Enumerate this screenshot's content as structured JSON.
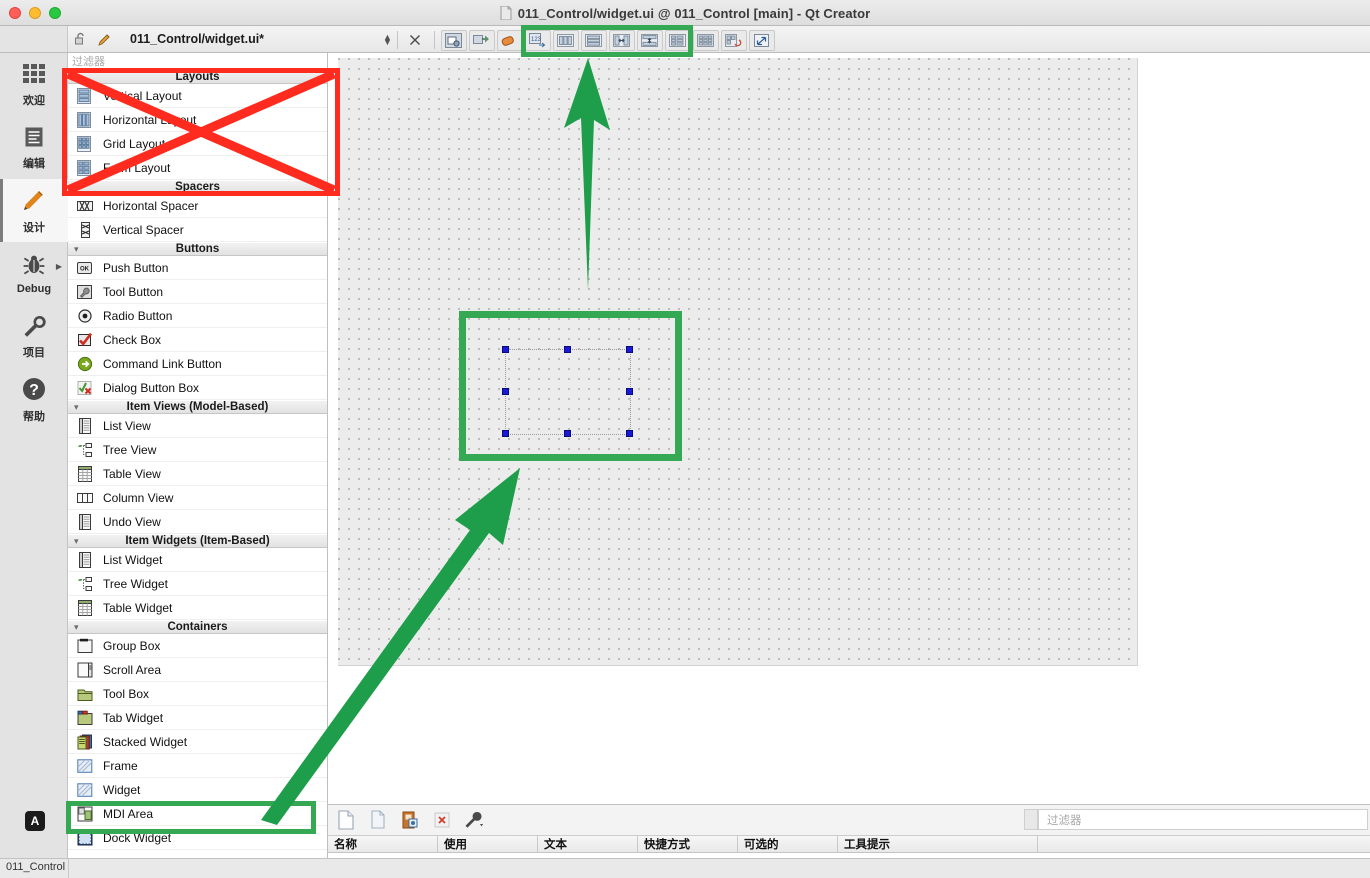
{
  "window": {
    "title": "011_Control/widget.ui @ 011_Control [main] - Qt Creator",
    "doc_icon": "document-icon",
    "traffic": {
      "close": "close-window-button",
      "minimize": "minimize-window-button",
      "zoom": "zoom-window-button"
    }
  },
  "editor_toolbar": {
    "lock_icon": "unlocked-padlock-icon",
    "edit_icon": "pencil-edit-icon",
    "file_name": "011_Control/widget.ui*",
    "dropdown_icon": "updown-chevron-icon",
    "close_icon": "close-editor-icon",
    "designer_buttons": [
      {
        "name": "edit-widgets-button",
        "icon": "edit-widgets-icon"
      },
      {
        "name": "edit-signals-slots-button",
        "icon": "signals-slots-icon"
      },
      {
        "name": "edit-buddies-button",
        "icon": "buddies-icon"
      },
      {
        "name": "edit-tab-order-button",
        "icon": "tab-order-icon"
      },
      {
        "name": "layout-horizontally-button",
        "icon": "layout-horizontal-icon"
      },
      {
        "name": "layout-vertically-button",
        "icon": "layout-vertical-icon"
      },
      {
        "name": "layout-horizontally-splitter-button",
        "icon": "splitter-horizontal-icon"
      },
      {
        "name": "layout-vertically-splitter-button",
        "icon": "splitter-vertical-icon"
      },
      {
        "name": "layout-form-button",
        "icon": "form-layout-icon"
      },
      {
        "name": "layout-grid-button",
        "icon": "grid-layout-icon"
      },
      {
        "name": "break-layout-button",
        "icon": "break-layout-icon"
      },
      {
        "name": "adjust-size-button",
        "icon": "adjust-size-icon"
      }
    ]
  },
  "mode_bar": {
    "items": [
      {
        "label": "欢迎",
        "icon": "welcome-grid-icon",
        "active": false,
        "has_arrow": false
      },
      {
        "label": "编辑",
        "icon": "edit-document-icon",
        "active": false,
        "has_arrow": false
      },
      {
        "label": "设计",
        "icon": "design-pencil-icon",
        "active": true,
        "has_arrow": false
      },
      {
        "label": "Debug",
        "icon": "debug-bug-icon",
        "active": false,
        "has_arrow": true
      },
      {
        "label": "项目",
        "icon": "projects-wrench-icon",
        "active": false,
        "has_arrow": false
      },
      {
        "label": "帮助",
        "icon": "help-question-icon",
        "active": false,
        "has_arrow": false
      }
    ],
    "badge": "A"
  },
  "status_bar": {
    "project": "011_Control"
  },
  "widget_box": {
    "filter_placeholder": "过滤器",
    "groups": [
      {
        "label": "Layouts",
        "items": [
          {
            "label": "Vertical Layout",
            "icon": "vertical-layout-icon"
          },
          {
            "label": "Horizontal Layout",
            "icon": "horizontal-layout-icon"
          },
          {
            "label": "Grid Layout",
            "icon": "grid-layout-icon"
          },
          {
            "label": "Form Layout",
            "icon": "form-layout-icon"
          }
        ]
      },
      {
        "label": "Spacers",
        "items": [
          {
            "label": "Horizontal Spacer",
            "icon": "horizontal-spacer-icon"
          },
          {
            "label": "Vertical Spacer",
            "icon": "vertical-spacer-icon"
          }
        ]
      },
      {
        "label": "Buttons",
        "items": [
          {
            "label": "Push Button",
            "icon": "push-button-icon"
          },
          {
            "label": "Tool Button",
            "icon": "tool-button-icon"
          },
          {
            "label": "Radio Button",
            "icon": "radio-button-icon"
          },
          {
            "label": "Check Box",
            "icon": "check-box-icon"
          },
          {
            "label": "Command Link Button",
            "icon": "command-link-button-icon"
          },
          {
            "label": "Dialog Button Box",
            "icon": "dialog-button-box-icon"
          }
        ]
      },
      {
        "label": "Item Views (Model-Based)",
        "items": [
          {
            "label": "List View",
            "icon": "list-view-icon"
          },
          {
            "label": "Tree View",
            "icon": "tree-view-icon"
          },
          {
            "label": "Table View",
            "icon": "table-view-icon"
          },
          {
            "label": "Column View",
            "icon": "column-view-icon"
          },
          {
            "label": "Undo View",
            "icon": "undo-view-icon"
          }
        ]
      },
      {
        "label": "Item Widgets (Item-Based)",
        "items": [
          {
            "label": "List Widget",
            "icon": "list-widget-icon"
          },
          {
            "label": "Tree Widget",
            "icon": "tree-widget-icon"
          },
          {
            "label": "Table Widget",
            "icon": "table-widget-icon"
          }
        ]
      },
      {
        "label": "Containers",
        "items": [
          {
            "label": "Group Box",
            "icon": "group-box-icon"
          },
          {
            "label": "Scroll Area",
            "icon": "scroll-area-icon"
          },
          {
            "label": "Tool Box",
            "icon": "tool-box-icon"
          },
          {
            "label": "Tab Widget",
            "icon": "tab-widget-icon"
          },
          {
            "label": "Stacked Widget",
            "icon": "stacked-widget-icon"
          },
          {
            "label": "Frame",
            "icon": "frame-icon"
          },
          {
            "label": "Widget",
            "icon": "widget-icon"
          },
          {
            "label": "MDI Area",
            "icon": "mdi-area-icon"
          },
          {
            "label": "Dock Widget",
            "icon": "dock-widget-icon"
          }
        ]
      }
    ]
  },
  "action_editor": {
    "buttons": [
      {
        "name": "new-action-button",
        "icon": "new-document-icon"
      },
      {
        "name": "copy-action-button",
        "icon": "copy-document-icon"
      },
      {
        "name": "paste-action-button",
        "icon": "paste-clipboard-icon"
      },
      {
        "name": "delete-action-button",
        "icon": "delete-red-x-icon"
      },
      {
        "name": "configure-action-button",
        "icon": "wrench-dropdown-icon"
      }
    ],
    "filter_placeholder": "过滤器",
    "columns": [
      "名称",
      "使用",
      "文本",
      "快捷方式",
      "可选的",
      "工具提示"
    ],
    "rows": []
  },
  "annotations": {
    "red_color": "#ff2b1e",
    "green_color": "#35a853",
    "red_cross_target": "Layouts",
    "green_box_toolbar": "layout-toolbar-buttons",
    "green_box_canvas": "selected-widget",
    "green_box_sidebar": "Widget"
  },
  "canvas": {
    "selection_handles": 8,
    "grid": "dotted"
  }
}
